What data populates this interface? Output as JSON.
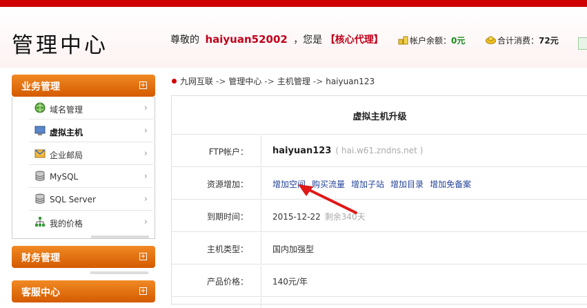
{
  "header": {
    "title": "管理中心",
    "greet_prefix": "尊敬的",
    "username": "haiyuan52002",
    "greet_mid": "，您是",
    "role": "【核心代理】",
    "balance_label": "帐户余额：",
    "balance_value": "0元",
    "spend_label": "合计消费：",
    "spend_value": "72元"
  },
  "sidebar": {
    "sections": [
      {
        "label": "业务管理"
      },
      {
        "label": "财务管理"
      },
      {
        "label": "客服中心"
      }
    ],
    "items": [
      {
        "label": "域名管理",
        "icon": "globe-icon"
      },
      {
        "label": "虚拟主机",
        "icon": "monitor-icon"
      },
      {
        "label": "企业邮局",
        "icon": "mail-icon"
      },
      {
        "label": "MySQL",
        "icon": "database-icon"
      },
      {
        "label": "SQL Server",
        "icon": "database-icon"
      },
      {
        "label": "我的价格",
        "icon": "sitemap-icon"
      }
    ]
  },
  "breadcrumb": [
    "九网互联",
    "管理中心",
    "主机管理",
    "haiyuan123"
  ],
  "panel": {
    "title": "虚拟主机升级",
    "ftp_label": "FTP帐户：",
    "ftp_value": "haiyuan123",
    "ftp_host": "( hai.w61.zndns.net )",
    "resource_label": "资源增加：",
    "resource_links": [
      "增加空间",
      "购买流量",
      "增加子站",
      "增加目录",
      "增加免备案"
    ],
    "expire_label": "到期时间：",
    "expire_value": "2015-12-22",
    "expire_remaining": "剩余340天",
    "type_label": "主机类型：",
    "type_value": "国内加强型",
    "price_label": "产品价格：",
    "price_value": "140元/年"
  },
  "colors": {
    "brand_red": "#d10000",
    "accent_orange": "#e0700f",
    "link_blue": "#24449a"
  }
}
